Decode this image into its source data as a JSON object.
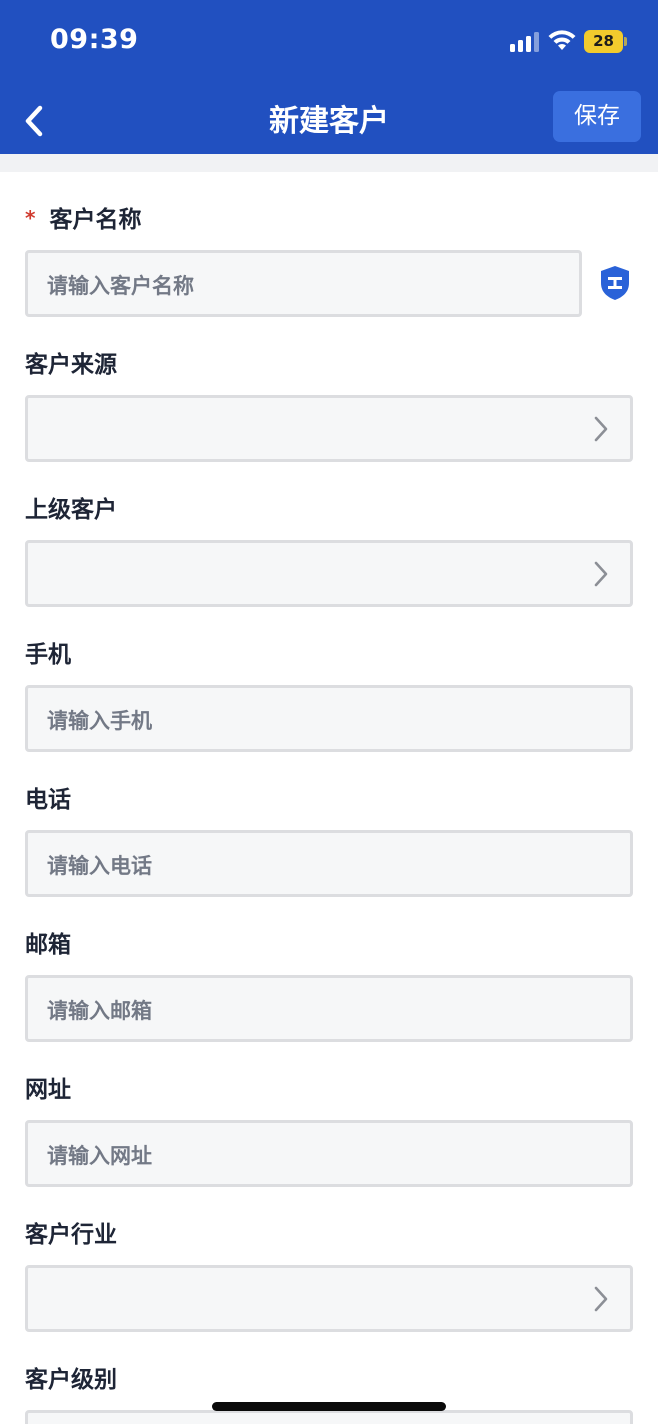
{
  "status_bar": {
    "time": "09:39",
    "battery": "28",
    "icons": [
      "cellular-signal-icon",
      "wifi-icon",
      "battery-icon"
    ]
  },
  "nav": {
    "back_icon": "chevron-left-icon",
    "title": "新建客户",
    "save_label": "保存"
  },
  "colors": {
    "header": "#2150c0",
    "save_button": "#3a6fdf",
    "required": "#d03a2e",
    "label": "#1e2536",
    "battery": "#f2cb2d",
    "shield": "#2a62d8"
  },
  "form": {
    "name_label": "客户名称",
    "name_required": "*",
    "name_placeholder": "请输入客户名称",
    "name_side_icon": "shield-icon",
    "source_label": "客户来源",
    "source_value": "",
    "parent_label": "上级客户",
    "parent_value": "",
    "mobile_label": "手机",
    "mobile_placeholder": "请输入手机",
    "phone_label": "电话",
    "phone_placeholder": "请输入电话",
    "email_label": "邮箱",
    "email_placeholder": "请输入邮箱",
    "website_label": "网址",
    "website_placeholder": "请输入网址",
    "industry_label": "客户行业",
    "industry_value": "",
    "level_label": "客户级别"
  }
}
